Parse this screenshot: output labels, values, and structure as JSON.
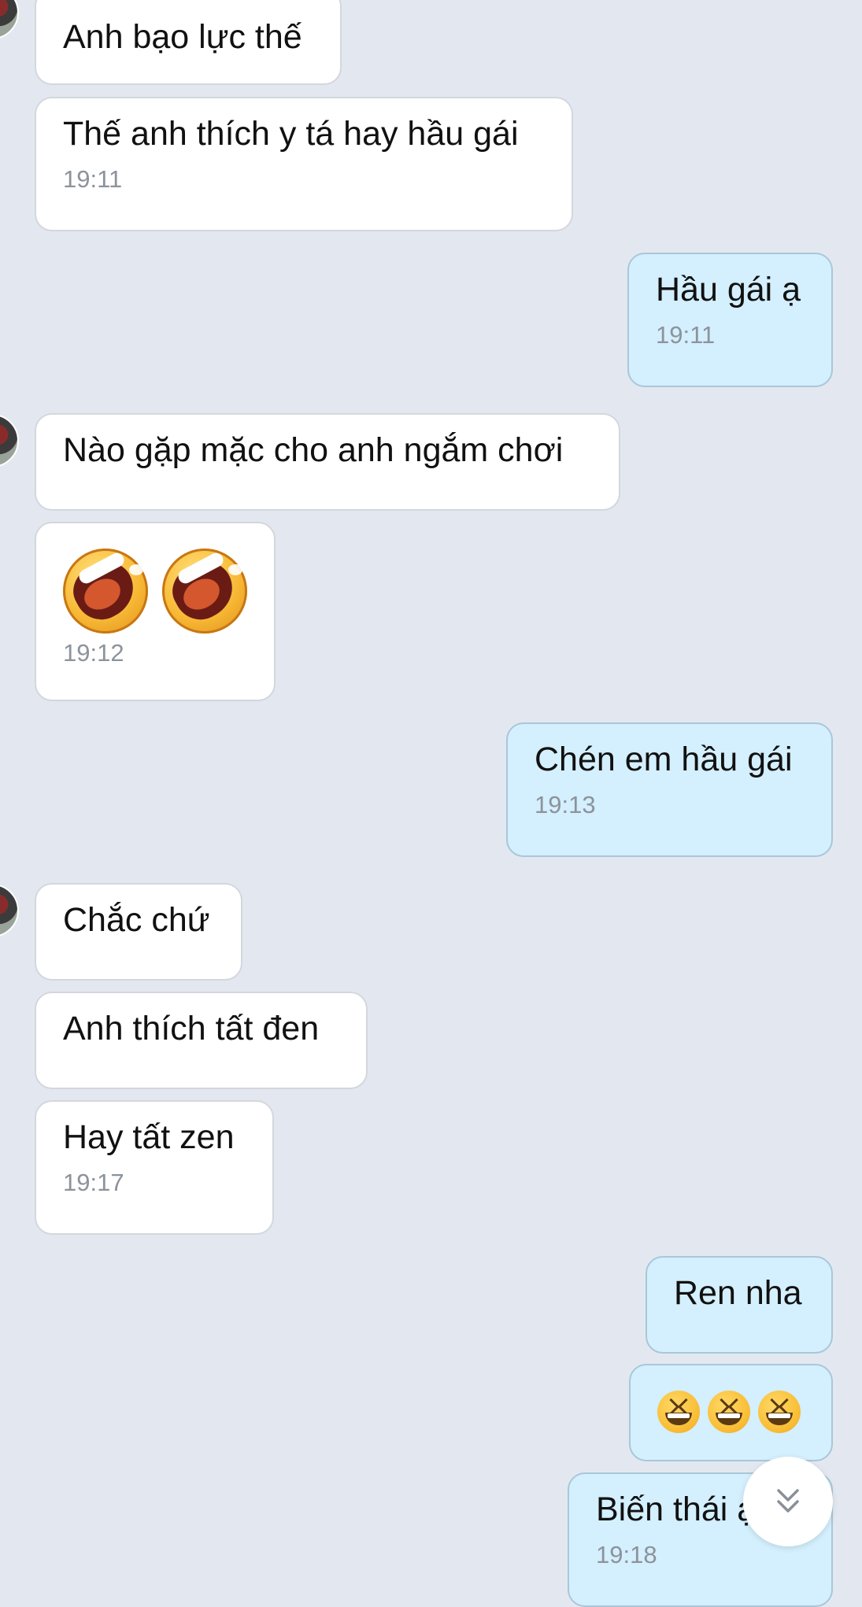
{
  "messages": [
    {
      "direction": "incoming",
      "text": "Anh bạo lực thế",
      "time": ""
    },
    {
      "direction": "incoming",
      "text": "Thế anh thích y tá hay hầu gái",
      "time": "19:11"
    },
    {
      "direction": "outgoing",
      "text": "Hầu gái ạ",
      "time": "19:11"
    },
    {
      "direction": "incoming",
      "text": "Nào gặp mặc cho anh ngắm chơi",
      "time": ""
    },
    {
      "direction": "incoming",
      "emoji": [
        "laughing-face",
        "laughing-face"
      ],
      "time": "19:12"
    },
    {
      "direction": "outgoing",
      "text": "Chén em hầu gái",
      "time": "19:13"
    },
    {
      "direction": "incoming",
      "text": "Chắc chứ",
      "time": ""
    },
    {
      "direction": "incoming",
      "text": "Anh thích tất đen",
      "time": ""
    },
    {
      "direction": "incoming",
      "text": "Hay tất zen",
      "time": "19:17"
    },
    {
      "direction": "outgoing",
      "text": "Ren nha",
      "time": ""
    },
    {
      "direction": "outgoing",
      "emoji": [
        "grinning-squinting-face",
        "grinning-squinting-face",
        "grinning-squinting-face"
      ],
      "time": ""
    },
    {
      "direction": "outgoing",
      "text": "Biến thái ạ",
      "time": "19:18"
    }
  ],
  "colors": {
    "background": "#e3e8f0",
    "incoming_bubble": "#ffffff",
    "outgoing_bubble": "#d4effd",
    "timestamp": "#8c939b"
  },
  "icons": {
    "scroll_button": "chevrons-down-icon"
  }
}
